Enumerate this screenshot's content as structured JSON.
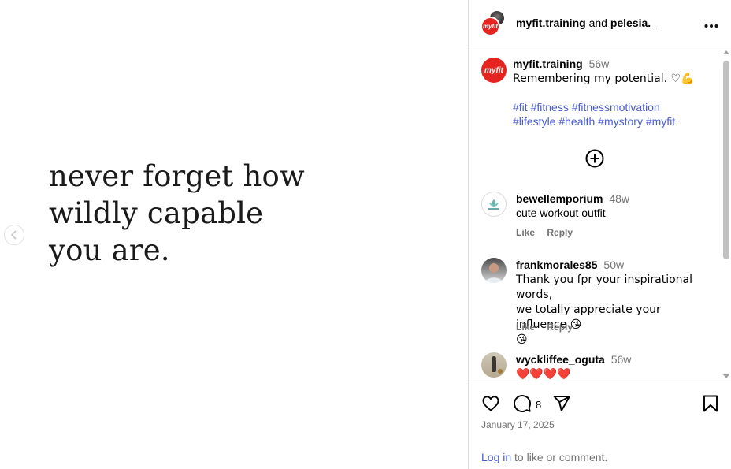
{
  "post": {
    "quote_lines": [
      "never forget how",
      "wildly capable",
      "you are."
    ]
  },
  "header": {
    "account": "myfit.training",
    "and": "and",
    "collaborator": "pelesia._",
    "logo_text": "myfit"
  },
  "caption": {
    "username": "myfit.training",
    "time": "56w",
    "text": "Remembering my potential. ♡💪",
    "hashtags_line1": "#fit #fitness #fitnessmotivation",
    "hashtags_line2": "#lifestyle #health #mystory #myfit"
  },
  "comments": [
    {
      "username": "bewellemporium",
      "time": "48w",
      "text": "cute workout outfit",
      "like": "Like",
      "reply": "Reply"
    },
    {
      "username": "frankmorales85",
      "time": "50w",
      "text_line1": "Thank you fpr your inspirational words,",
      "text_line2": "we totally appreciate your influence 😘",
      "text_line3": "😘",
      "like": "Like",
      "reply": "Reply"
    },
    {
      "username": "wyckliffee_oguta",
      "time": "56w",
      "text": "❤️❤️❤️❤️"
    }
  ],
  "footer": {
    "comment_count": "8",
    "date": "January 17, 2025",
    "login_link": "Log in",
    "login_rest": " to like or comment."
  },
  "icons": {
    "more": "more-options-icon",
    "like": "heart-icon",
    "comment": "comment-icon",
    "share": "share-icon",
    "save": "bookmark-icon",
    "add": "add-circle-icon",
    "prev": "chevron-left-icon"
  },
  "colors": {
    "brand_red": "#e52421",
    "link_blue": "#4a5bd4",
    "muted": "#737373"
  }
}
